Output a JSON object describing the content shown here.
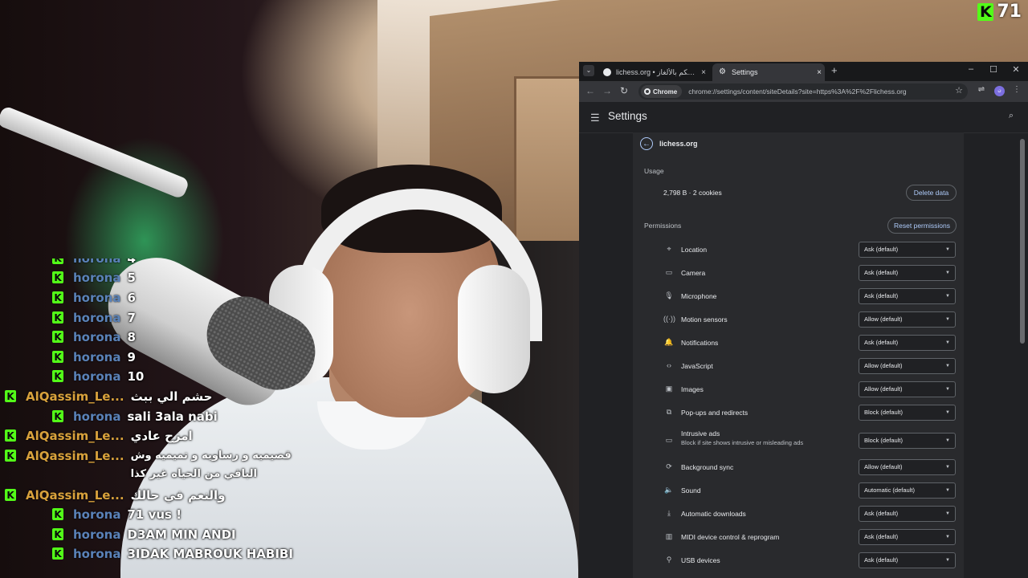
{
  "alert": {
    "count": "71"
  },
  "chat": {
    "lines": [
      {
        "user": "horona",
        "message": "4",
        "color": "horona"
      },
      {
        "user": "horona",
        "message": "5",
        "color": "horona"
      },
      {
        "user": "horona",
        "message": "6",
        "color": "horona"
      },
      {
        "user": "horona",
        "message": "7",
        "color": "horona"
      },
      {
        "user": "horona",
        "message": "8",
        "color": "horona"
      },
      {
        "user": "horona",
        "message": "9",
        "color": "horona"
      },
      {
        "user": "horona",
        "message": "10",
        "color": "horona"
      },
      {
        "user": "AlQassim_Le...",
        "message": "حشم الي ببث",
        "color": "qassim"
      },
      {
        "user": "horona",
        "message": "sali 3ala nabi",
        "color": "horona"
      },
      {
        "user": "AlQassim_Le...",
        "message": "امزح عادي",
        "color": "qassim"
      },
      {
        "user": "AlQassim_Le...",
        "message": "قصيميه و رساويه و تميميه وش الباقي من الحياه غير كذا",
        "color": "qassim"
      },
      {
        "user": "AlQassim_Le...",
        "message": "والنعم في حالك",
        "color": "qassim"
      },
      {
        "user": "horona",
        "message": "71 vus !",
        "color": "horona"
      },
      {
        "user": "horona",
        "message": "D3AM MIN ANDI",
        "color": "horona"
      },
      {
        "user": "horona",
        "message": "3IDAK MABROUK HABIBI",
        "color": "horona"
      }
    ]
  },
  "browser": {
    "tabs": [
      {
        "title": "lichess.org • لوحة التحكم بالألغاز",
        "close": "×"
      },
      {
        "title": "Settings",
        "close": "×"
      }
    ],
    "new_tab": "+",
    "window_controls": {
      "minimize": "–",
      "maximize": "☐",
      "close": "✕"
    },
    "chip_label": "Chrome",
    "url": "chrome://settings/content/siteDetails?site=https%3A%2F%2Flichess.org",
    "settings_title": "Settings",
    "site_name": "lichess.org",
    "usage_label": "Usage",
    "usage_text": "2,798 B · 2 cookies",
    "delete_data": "Delete data",
    "permissions_label": "Permissions",
    "reset_permissions": "Reset permissions",
    "permissions": [
      {
        "label": "Location",
        "value": "Ask (default)",
        "icon": "location-icon",
        "glyph": "⌖"
      },
      {
        "label": "Camera",
        "value": "Ask (default)",
        "icon": "camera-icon",
        "glyph": "▭"
      },
      {
        "label": "Microphone",
        "value": "Ask (default)",
        "icon": "microphone-icon",
        "glyph": "🎙"
      },
      {
        "label": "Motion sensors",
        "value": "Allow (default)",
        "icon": "motion-sensors-icon",
        "glyph": "((·))"
      },
      {
        "label": "Notifications",
        "value": "Ask (default)",
        "icon": "bell-icon",
        "glyph": "🔔"
      },
      {
        "label": "JavaScript",
        "value": "Allow (default)",
        "icon": "code-icon",
        "glyph": "‹›"
      },
      {
        "label": "Images",
        "value": "Allow (default)",
        "icon": "image-icon",
        "glyph": "▣"
      },
      {
        "label": "Pop-ups and redirects",
        "value": "Block (default)",
        "icon": "popup-icon",
        "glyph": "⧉"
      },
      {
        "label": "Intrusive ads",
        "sub": "Block if site shows intrusive or misleading ads",
        "value": "Block (default)",
        "icon": "ads-icon",
        "glyph": "▭"
      },
      {
        "label": "Background sync",
        "value": "Allow (default)",
        "icon": "sync-icon",
        "glyph": "⟳"
      },
      {
        "label": "Sound",
        "value": "Automatic (default)",
        "icon": "sound-icon",
        "glyph": "🔈"
      },
      {
        "label": "Automatic downloads",
        "value": "Ask (default)",
        "icon": "download-icon",
        "glyph": "⤓"
      },
      {
        "label": "MIDI device control & reprogram",
        "value": "Ask (default)",
        "icon": "midi-icon",
        "glyph": "▥"
      },
      {
        "label": "USB devices",
        "value": "Ask (default)",
        "icon": "usb-icon",
        "glyph": "⚲"
      }
    ]
  },
  "colors": {
    "kick_green": "#53fc18",
    "horona": "#5a82b8",
    "qassim": "#d9a23c",
    "chrome_bg": "#202124",
    "link_blue": "#aecbfa"
  }
}
